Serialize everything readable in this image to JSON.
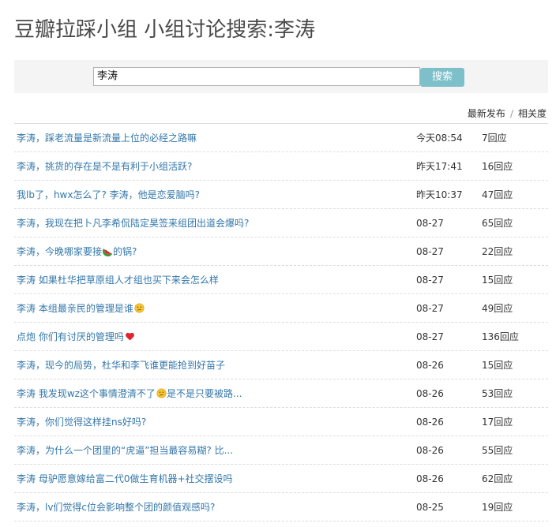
{
  "header": {
    "title": "豆瓣拉踩小组 小组讨论搜索:李涛"
  },
  "search": {
    "value": "李涛",
    "button_label": "搜索"
  },
  "sort": {
    "latest_label": "最新发布",
    "separator": "/",
    "relevance_label": "相关度"
  },
  "topics": [
    {
      "parts": [
        "李涛，踩老流量是新流量上位的必经之路嘛"
      ],
      "time": "今天08:54",
      "replies": "7回应"
    },
    {
      "parts": [
        "李涛，挑货的存在是不是有利于小组活跃?"
      ],
      "time": "昨天17:41",
      "replies": "16回应"
    },
    {
      "parts": [
        "我lb了，hwx怎么了? 李涛，他是恋爱脑吗?"
      ],
      "time": "昨天10:37",
      "replies": "47回应"
    },
    {
      "parts": [
        "李涛，我现在把卜凡李希侃陆定昊签来组团出道会爆吗?"
      ],
      "time": "08-27",
      "replies": "65回应"
    },
    {
      "parts": [
        "李涛，今晚哪家要接",
        "的锅?"
      ],
      "emoji": "watermelon-icon",
      "time": "08-27",
      "replies": "22回应"
    },
    {
      "parts": [
        "李涛 如果杜华把草原组人才组也买下来会怎么样"
      ],
      "time": "08-27",
      "replies": "15回应"
    },
    {
      "parts": [
        "李涛 本组最亲民的管理是谁",
        ""
      ],
      "emoji": "thinking-face-icon",
      "time": "08-27",
      "replies": "49回应"
    },
    {
      "parts": [
        "点炮 你们有讨厌的管理吗",
        ""
      ],
      "emoji": "heart-icon",
      "time": "08-27",
      "replies": "136回应"
    },
    {
      "parts": [
        "李涛，现今的局势，杜华和李飞谁更能抢到好苗子"
      ],
      "time": "08-26",
      "replies": "15回应"
    },
    {
      "parts": [
        "李涛 我发现wz这个事情澄清不了",
        "是不是只要被路..."
      ],
      "emoji": "thinking-face-icon",
      "time": "08-26",
      "replies": "53回应"
    },
    {
      "parts": [
        "李涛，你们觉得这样挂ns好吗?"
      ],
      "time": "08-26",
      "replies": "17回应"
    },
    {
      "parts": [
        "李涛，为什么一个团里的“虎逼”担当最容易糊? 比..."
      ],
      "time": "08-26",
      "replies": "55回应"
    },
    {
      "parts": [
        "李涛 母驴愿意嫁给富二代0做生育机器+社交摆设吗"
      ],
      "time": "08-26",
      "replies": "62回应"
    },
    {
      "parts": [
        "李涛，lv们觉得c位会影响整个团的颜值观感吗?"
      ],
      "time": "08-25",
      "replies": "19回应"
    }
  ],
  "colors": {
    "link": "#3377aa",
    "button": "#7ec0c9",
    "search_bar_bg": "#f4f4f4",
    "title": "#494949"
  }
}
